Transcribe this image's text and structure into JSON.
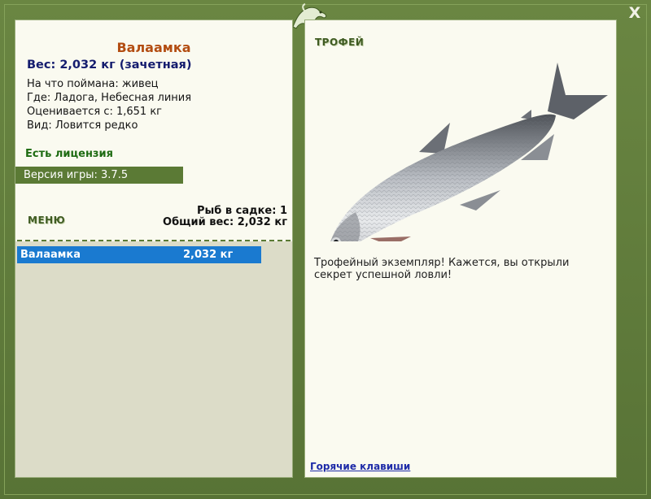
{
  "window": {
    "close_label": "X"
  },
  "fish": {
    "name": "Валаамка",
    "weight_line": "Вес: 2,032 кг (зачетная)",
    "bait": "На что поймана: живец",
    "location": "Где: Ладога, Небесная линия",
    "rated_from": "Оценивается с: 1,651 кг",
    "kind": "Вид: Ловится редко"
  },
  "license_text": "Есть лицензия",
  "version_text": "Версия игры: 3.7.5",
  "menu_label": "МЕНЮ",
  "keepnet": {
    "count_text": "Рыб в садке: 1",
    "total_text": "Общий вес: 2,032 кг",
    "rows": [
      {
        "name": "Валаамка",
        "weight": "2,032 кг"
      }
    ]
  },
  "trophy": {
    "label": "ТРОФЕЙ",
    "description": "Трофейный экземпляр! Кажется, вы открыли секрет успешной ловли!"
  },
  "hotkeys_label": "Горячие клавиши",
  "colors": {
    "frame": "#5e7a3a",
    "panel": "#fafaf0",
    "selection": "#1a7ad0",
    "title": "#b34d12",
    "weight": "#141c6e",
    "license": "#1e6b12"
  },
  "icons": {
    "logo": "lizard-logo-icon",
    "close": "close-icon"
  }
}
